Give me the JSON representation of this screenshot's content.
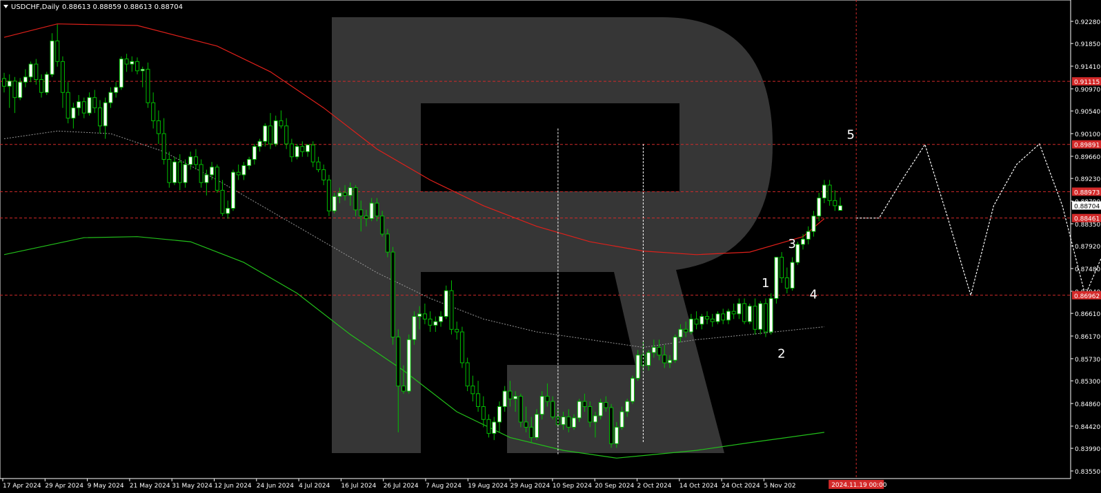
{
  "header": {
    "symbol_label": "USDCHF,Daily",
    "ohlc": "0.88613 0.88859 0.88613 0.88704"
  },
  "colors": {
    "background": "#000000",
    "candle_up": "#00c000",
    "candle_down": "#ffffff",
    "ma_fast": "#e0201a",
    "ma_slow": "#22c11a",
    "ma_dotted": "#9a9a9a",
    "level_line": "#d42a2a",
    "forecast": "#ffffff",
    "axis_text": "#ffffff",
    "level_tag_bg": "#d42a2a"
  },
  "chart_data": {
    "type": "candlestick",
    "price_axis": {
      "ticks": [
        "0.92280",
        "0.91850",
        "0.91410",
        "0.90970",
        "0.90540",
        "0.90100",
        "0.89660",
        "0.89230",
        "0.88790",
        "0.88350",
        "0.87920",
        "0.87480",
        "0.87040",
        "0.86610",
        "0.86170",
        "0.85730",
        "0.85300",
        "0.84860",
        "0.84420",
        "0.83990",
        "0.83550"
      ],
      "ylim": [
        0.8355,
        0.927
      ]
    },
    "time_axis": {
      "ticks": [
        "17 Apr 2024",
        "29 Apr 2024",
        "9 May 2024",
        "21 May 2024",
        "31 May 2024",
        "12 Jun 2024",
        "24 Jun 2024",
        "4 Jul 2024",
        "16 Jul 2024",
        "26 Jul 2024",
        "7 Aug 2024",
        "19 Aug 2024",
        "29 Aug 2024",
        "10 Sep 2024",
        "20 Sep 2024",
        "2 Oct 2024",
        "14 Oct 2024",
        "24 Oct 2024",
        "5 Nov 202"
      ],
      "cursor_label": "2024.11.19 00:00"
    },
    "levels": [
      {
        "value": 0.91115,
        "label": "0.91115"
      },
      {
        "value": 0.89891,
        "label": "0.89891"
      },
      {
        "value": 0.88973,
        "label": "0.88973"
      },
      {
        "value": 0.88461,
        "label": "0.88461"
      },
      {
        "value": 0.86962,
        "label": "0.86962"
      }
    ],
    "current_price": {
      "value": 0.88704,
      "label": "0.88704"
    },
    "candles": [
      [
        0.9117,
        0.9128,
        0.909,
        0.9102
      ],
      [
        0.9102,
        0.9125,
        0.906,
        0.9112
      ],
      [
        0.9112,
        0.912,
        0.905,
        0.908
      ],
      [
        0.908,
        0.9118,
        0.9075,
        0.911
      ],
      [
        0.911,
        0.9135,
        0.91,
        0.912
      ],
      [
        0.912,
        0.915,
        0.911,
        0.9145
      ],
      [
        0.9145,
        0.9155,
        0.9105,
        0.9115
      ],
      [
        0.9115,
        0.9125,
        0.908,
        0.909
      ],
      [
        0.909,
        0.913,
        0.9085,
        0.9125
      ],
      [
        0.9125,
        0.9205,
        0.912,
        0.919
      ],
      [
        0.919,
        0.9222,
        0.914,
        0.915
      ],
      [
        0.915,
        0.916,
        0.906,
        0.909
      ],
      [
        0.909,
        0.911,
        0.903,
        0.904
      ],
      [
        0.904,
        0.907,
        0.902,
        0.906
      ],
      [
        0.906,
        0.9085,
        0.9045,
        0.9072
      ],
      [
        0.9072,
        0.908,
        0.904,
        0.905
      ],
      [
        0.905,
        0.909,
        0.9045,
        0.908
      ],
      [
        0.908,
        0.9095,
        0.905,
        0.906
      ],
      [
        0.906,
        0.9075,
        0.901,
        0.9025
      ],
      [
        0.9025,
        0.908,
        0.9,
        0.907
      ],
      [
        0.907,
        0.91,
        0.906,
        0.909
      ],
      [
        0.909,
        0.911,
        0.908,
        0.91
      ],
      [
        0.91,
        0.916,
        0.9095,
        0.9155
      ],
      [
        0.9155,
        0.9165,
        0.913,
        0.9145
      ],
      [
        0.9145,
        0.916,
        0.913,
        0.915
      ],
      [
        0.915,
        0.9158,
        0.9125,
        0.9132
      ],
      [
        0.9132,
        0.914,
        0.91,
        0.9135
      ],
      [
        0.9135,
        0.9148,
        0.906,
        0.907
      ],
      [
        0.907,
        0.909,
        0.902,
        0.9035
      ],
      [
        0.9035,
        0.9055,
        0.899,
        0.901
      ],
      [
        0.901,
        0.904,
        0.895,
        0.896
      ],
      [
        0.896,
        0.8975,
        0.8905,
        0.8915
      ],
      [
        0.8915,
        0.8965,
        0.891,
        0.8955
      ],
      [
        0.8955,
        0.897,
        0.89,
        0.8915
      ],
      [
        0.8915,
        0.896,
        0.8905,
        0.895
      ],
      [
        0.895,
        0.8975,
        0.894,
        0.8965
      ],
      [
        0.8965,
        0.898,
        0.894,
        0.895
      ],
      [
        0.895,
        0.896,
        0.8905,
        0.8915
      ],
      [
        0.8915,
        0.894,
        0.889,
        0.893
      ],
      [
        0.893,
        0.8955,
        0.892,
        0.8945
      ],
      [
        0.8945,
        0.895,
        0.8895,
        0.89
      ],
      [
        0.89,
        0.892,
        0.885,
        0.8855
      ],
      [
        0.8855,
        0.888,
        0.8845,
        0.8865
      ],
      [
        0.8865,
        0.894,
        0.886,
        0.8935
      ],
      [
        0.8935,
        0.895,
        0.892,
        0.893
      ],
      [
        0.893,
        0.8955,
        0.892,
        0.8948
      ],
      [
        0.8948,
        0.8965,
        0.894,
        0.896
      ],
      [
        0.896,
        0.899,
        0.895,
        0.8985
      ],
      [
        0.8985,
        0.9,
        0.8975,
        0.8995
      ],
      [
        0.8995,
        0.903,
        0.8985,
        0.9025
      ],
      [
        0.9025,
        0.905,
        0.898,
        0.899
      ],
      [
        0.899,
        0.9045,
        0.8985,
        0.9035
      ],
      [
        0.9035,
        0.9055,
        0.902,
        0.9025
      ],
      [
        0.9025,
        0.904,
        0.898,
        0.899
      ],
      [
        0.899,
        0.9,
        0.8955,
        0.8965
      ],
      [
        0.8965,
        0.899,
        0.896,
        0.8985
      ],
      [
        0.8985,
        0.8995,
        0.8965,
        0.8975
      ],
      [
        0.8975,
        0.899,
        0.8965,
        0.8988
      ],
      [
        0.8988,
        0.8995,
        0.8945,
        0.8955
      ],
      [
        0.8955,
        0.8965,
        0.8935,
        0.894
      ],
      [
        0.894,
        0.895,
        0.891,
        0.892
      ],
      [
        0.892,
        0.893,
        0.885,
        0.886
      ],
      [
        0.886,
        0.8895,
        0.8855,
        0.8888
      ],
      [
        0.8888,
        0.8905,
        0.8875,
        0.8895
      ],
      [
        0.8895,
        0.891,
        0.888,
        0.889
      ],
      [
        0.889,
        0.8915,
        0.887,
        0.8905
      ],
      [
        0.8905,
        0.891,
        0.885,
        0.8862
      ],
      [
        0.8862,
        0.888,
        0.882,
        0.885
      ],
      [
        0.885,
        0.8862,
        0.883,
        0.8845
      ],
      [
        0.8845,
        0.8885,
        0.884,
        0.8875
      ],
      [
        0.8875,
        0.8885,
        0.884,
        0.885
      ],
      [
        0.885,
        0.886,
        0.881,
        0.8815
      ],
      [
        0.8815,
        0.8825,
        0.877,
        0.878
      ],
      [
        0.878,
        0.879,
        0.86,
        0.8615
      ],
      [
        0.8615,
        0.863,
        0.843,
        0.852
      ],
      [
        0.852,
        0.856,
        0.8505,
        0.851
      ],
      [
        0.851,
        0.862,
        0.8505,
        0.861
      ],
      [
        0.861,
        0.8665,
        0.86,
        0.8655
      ],
      [
        0.8655,
        0.8675,
        0.863,
        0.866
      ],
      [
        0.866,
        0.868,
        0.864,
        0.865
      ],
      [
        0.865,
        0.8665,
        0.8625,
        0.8638
      ],
      [
        0.8638,
        0.8655,
        0.8625,
        0.8645
      ],
      [
        0.8645,
        0.8665,
        0.8635,
        0.8655
      ],
      [
        0.8655,
        0.8715,
        0.865,
        0.8705
      ],
      [
        0.8705,
        0.8725,
        0.862,
        0.863
      ],
      [
        0.863,
        0.8645,
        0.861,
        0.8625
      ],
      [
        0.8625,
        0.8635,
        0.8555,
        0.8565
      ],
      [
        0.8565,
        0.8575,
        0.851,
        0.852
      ],
      [
        0.852,
        0.854,
        0.849,
        0.8505
      ],
      [
        0.8505,
        0.853,
        0.847,
        0.848
      ],
      [
        0.848,
        0.85,
        0.844,
        0.8455
      ],
      [
        0.8455,
        0.8465,
        0.842,
        0.8428
      ],
      [
        0.8428,
        0.846,
        0.8415,
        0.845
      ],
      [
        0.845,
        0.849,
        0.843,
        0.848
      ],
      [
        0.848,
        0.852,
        0.847,
        0.851
      ],
      [
        0.851,
        0.853,
        0.848,
        0.8495
      ],
      [
        0.8495,
        0.851,
        0.847,
        0.85
      ],
      [
        0.85,
        0.8505,
        0.844,
        0.845
      ],
      [
        0.845,
        0.848,
        0.843,
        0.844
      ],
      [
        0.844,
        0.846,
        0.841,
        0.842
      ],
      [
        0.842,
        0.8475,
        0.8415,
        0.8465
      ],
      [
        0.8465,
        0.851,
        0.8455,
        0.85
      ],
      [
        0.85,
        0.8525,
        0.848,
        0.849
      ],
      [
        0.849,
        0.85,
        0.8455,
        0.846
      ],
      [
        0.846,
        0.8475,
        0.844,
        0.8445
      ],
      [
        0.8445,
        0.847,
        0.8435,
        0.846
      ],
      [
        0.846,
        0.8475,
        0.843,
        0.844
      ],
      [
        0.844,
        0.8465,
        0.8435,
        0.8458
      ],
      [
        0.8458,
        0.8495,
        0.845,
        0.849
      ],
      [
        0.849,
        0.8505,
        0.847,
        0.848
      ],
      [
        0.848,
        0.849,
        0.844,
        0.845
      ],
      [
        0.845,
        0.847,
        0.842,
        0.8462
      ],
      [
        0.8462,
        0.8495,
        0.8455,
        0.8488
      ],
      [
        0.8488,
        0.85,
        0.847,
        0.8478
      ],
      [
        0.8478,
        0.8485,
        0.84,
        0.8408
      ],
      [
        0.8408,
        0.845,
        0.84,
        0.844
      ],
      [
        0.844,
        0.848,
        0.8435,
        0.847
      ],
      [
        0.847,
        0.8495,
        0.846,
        0.849
      ],
      [
        0.849,
        0.854,
        0.8485,
        0.8535
      ],
      [
        0.8535,
        0.859,
        0.853,
        0.858
      ],
      [
        0.858,
        0.8605,
        0.855,
        0.856
      ],
      [
        0.856,
        0.859,
        0.855,
        0.8585
      ],
      [
        0.8585,
        0.861,
        0.8575,
        0.8595
      ],
      [
        0.8595,
        0.861,
        0.857,
        0.858
      ],
      [
        0.858,
        0.86,
        0.8555,
        0.8565
      ],
      [
        0.8565,
        0.858,
        0.8555,
        0.857
      ],
      [
        0.857,
        0.862,
        0.8565,
        0.8615
      ],
      [
        0.8615,
        0.864,
        0.8605,
        0.863
      ],
      [
        0.863,
        0.8645,
        0.8615,
        0.8625
      ],
      [
        0.8625,
        0.866,
        0.862,
        0.865
      ],
      [
        0.865,
        0.8665,
        0.863,
        0.864
      ],
      [
        0.864,
        0.866,
        0.863,
        0.8655
      ],
      [
        0.8655,
        0.8665,
        0.864,
        0.865
      ],
      [
        0.865,
        0.866,
        0.8635,
        0.8645
      ],
      [
        0.8645,
        0.8665,
        0.864,
        0.866
      ],
      [
        0.866,
        0.867,
        0.864,
        0.8648
      ],
      [
        0.8648,
        0.867,
        0.864,
        0.8665
      ],
      [
        0.8665,
        0.868,
        0.865,
        0.866
      ],
      [
        0.866,
        0.869,
        0.865,
        0.868
      ],
      [
        0.868,
        0.869,
        0.864,
        0.8645
      ],
      [
        0.8645,
        0.868,
        0.864,
        0.8675
      ],
      [
        0.8675,
        0.869,
        0.862,
        0.863
      ],
      [
        0.863,
        0.8685,
        0.862,
        0.868
      ],
      [
        0.868,
        0.869,
        0.8615,
        0.8625
      ],
      [
        0.8625,
        0.87,
        0.862,
        0.869
      ],
      [
        0.869,
        0.874,
        0.868,
        0.877
      ],
      [
        0.877,
        0.878,
        0.872,
        0.873
      ],
      [
        0.873,
        0.875,
        0.87,
        0.871
      ],
      [
        0.871,
        0.877,
        0.8705,
        0.876
      ],
      [
        0.876,
        0.88,
        0.8755,
        0.8795
      ],
      [
        0.8795,
        0.8815,
        0.8785,
        0.8805
      ],
      [
        0.8805,
        0.883,
        0.8795,
        0.882
      ],
      [
        0.882,
        0.886,
        0.881,
        0.885
      ],
      [
        0.885,
        0.8895,
        0.884,
        0.8885
      ],
      [
        0.8885,
        0.892,
        0.8875,
        0.891
      ],
      [
        0.891,
        0.892,
        0.887,
        0.888
      ],
      [
        0.888,
        0.89,
        0.886,
        0.887
      ],
      [
        0.8861,
        0.8886,
        0.8861,
        0.887
      ]
    ],
    "ma_fast": [
      [
        0,
        0.9197
      ],
      [
        10,
        0.9223
      ],
      [
        25,
        0.922
      ],
      [
        40,
        0.918
      ],
      [
        50,
        0.913
      ],
      [
        60,
        0.906
      ],
      [
        70,
        0.898
      ],
      [
        80,
        0.892
      ],
      [
        90,
        0.887
      ],
      [
        100,
        0.883
      ],
      [
        110,
        0.88
      ],
      [
        120,
        0.8782
      ],
      [
        130,
        0.8775
      ],
      [
        140,
        0.878
      ],
      [
        150,
        0.881
      ],
      [
        154,
        0.8845
      ]
    ],
    "ma_slow": [
      [
        0,
        0.8775
      ],
      [
        15,
        0.8808
      ],
      [
        25,
        0.881
      ],
      [
        35,
        0.88
      ],
      [
        45,
        0.876
      ],
      [
        55,
        0.87
      ],
      [
        65,
        0.862
      ],
      [
        75,
        0.855
      ],
      [
        85,
        0.847
      ],
      [
        95,
        0.842
      ],
      [
        105,
        0.8395
      ],
      [
        115,
        0.838
      ],
      [
        120,
        0.8385
      ],
      [
        130,
        0.8395
      ],
      [
        140,
        0.841
      ],
      [
        154,
        0.843
      ]
    ],
    "ma_dotted": [
      [
        0,
        0.9
      ],
      [
        10,
        0.9015
      ],
      [
        20,
        0.901
      ],
      [
        30,
        0.8975
      ],
      [
        40,
        0.892
      ],
      [
        50,
        0.886
      ],
      [
        60,
        0.88
      ],
      [
        70,
        0.874
      ],
      [
        80,
        0.869
      ],
      [
        90,
        0.865
      ],
      [
        100,
        0.8625
      ],
      [
        110,
        0.861
      ],
      [
        120,
        0.8595
      ],
      [
        130,
        0.861
      ],
      [
        140,
        0.862
      ],
      [
        154,
        0.8635
      ]
    ],
    "wave_labels": [
      "1",
      "2",
      "3",
      "4",
      "5"
    ],
    "forecast": [
      [
        0.8846,
        0.8846
      ],
      [
        0.892,
        0.8989
      ],
      [
        0.8846,
        0.8696
      ],
      [
        0.887,
        0.895
      ],
      [
        0.899,
        0.887
      ],
      [
        0.8696,
        0.88
      ],
      [
        0.899,
        0.93
      ]
    ],
    "forecast_tail": [
      0.876,
      0.892
    ]
  }
}
